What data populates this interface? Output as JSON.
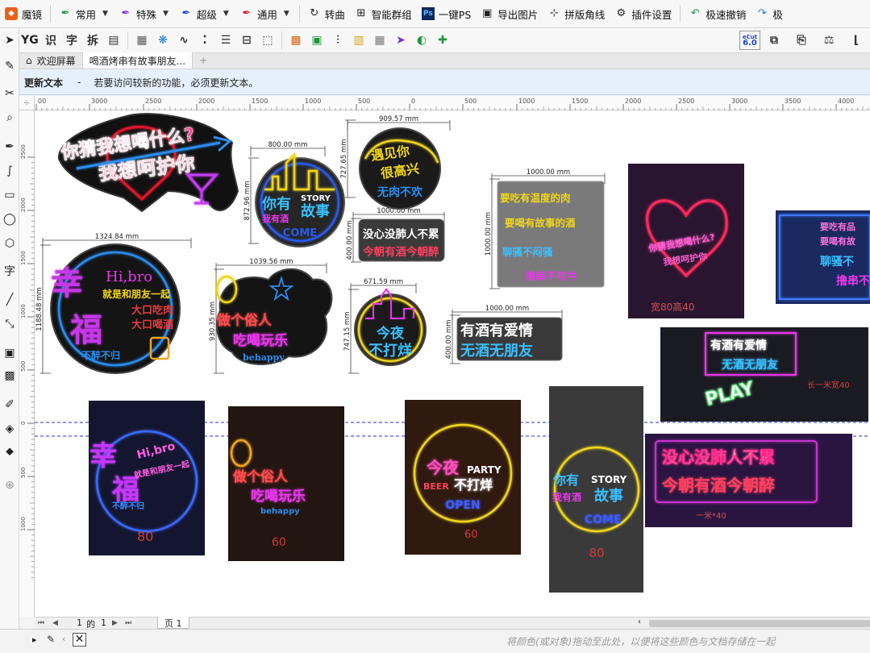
{
  "toolbar": {
    "app_title": "魔镜",
    "items": [
      {
        "label": "常用",
        "icon": "pen-icon",
        "dropdown": true
      },
      {
        "label": "特殊",
        "icon": "pen-icon",
        "dropdown": true
      },
      {
        "label": "超级",
        "icon": "pen-icon",
        "dropdown": true
      },
      {
        "label": "通用",
        "icon": "pen-icon",
        "dropdown": true
      },
      {
        "label": "转曲",
        "icon": "rotate-icon",
        "dropdown": false
      },
      {
        "label": "智能群组",
        "icon": "group-icon",
        "dropdown": false
      },
      {
        "label": "一键PS",
        "icon": "ps-icon",
        "dropdown": false
      },
      {
        "label": "导出图片",
        "icon": "image-icon",
        "dropdown": false
      },
      {
        "label": "拼版角线",
        "icon": "crop-mark-icon",
        "dropdown": false
      },
      {
        "label": "插件设置",
        "icon": "gear-icon",
        "dropdown": false
      },
      {
        "label": "极速撤销",
        "icon": "undo-icon",
        "dropdown": false
      },
      {
        "label": "极",
        "icon": "redo-icon",
        "dropdown": false
      }
    ],
    "row2_text": [
      "识",
      "字",
      "拆"
    ],
    "cut_version": "6.0",
    "cut_label": "eCut"
  },
  "tabs": [
    {
      "label": "欢迎屏幕",
      "icon": "home-icon"
    },
    {
      "label": "喝酒烤串有故事朋友..."
    }
  ],
  "notice": {
    "title": "更新文本",
    "dash": "-",
    "message": "若要访问较新的功能，必须更新文本。"
  },
  "ruler": {
    "h_ticks": [
      "00",
      "3000",
      "2500",
      "2000",
      "1500",
      "1000",
      "500",
      "0",
      "500",
      "1000",
      "1500",
      "2000",
      "2500",
      "3000",
      "3500",
      "4000"
    ],
    "v_ticks": [
      "2500",
      "2000",
      "1500",
      "1000",
      "500",
      "0",
      "500",
      "1000"
    ]
  },
  "canvas": {
    "dimensions": [
      "800.00 mm",
      "872.96 mm",
      "909.57 mm",
      "727.65 mm",
      "1000.00 mm",
      "400.00 mm",
      "1000.00 mm",
      "1000.00 mm",
      "1324.84 mm",
      "1188.48 mm",
      "1039.56 mm",
      "930.35 mm",
      "671.59 mm",
      "747.15 mm",
      "1000.00 mm",
      "400.00 mm"
    ],
    "designs": {
      "d1": [
        "你猜我想喝什么?",
        "我想呵护你"
      ],
      "d2": [
        "你有",
        "STORY",
        "我有酒",
        "故事",
        "COME"
      ],
      "d3": [
        "遇见你",
        "很高兴",
        "无肉不欢"
      ],
      "d4": [
        "没心没肺人不累",
        "今朝有酒今朝醉"
      ],
      "d5": [
        "要吃有温度的肉",
        "要喝有故事的酒",
        "聊骚不闷骚",
        "撸串不吹牛"
      ],
      "d6": [
        "幸",
        "福",
        "Hi,bro",
        "就是和朋友一起",
        "大口吃肉",
        "大口喝酒",
        "不醉不归"
      ],
      "d7": [
        "做个俗人",
        "吃喝玩乐",
        "behappy"
      ],
      "d8": [
        "今夜",
        "不打烊"
      ],
      "d9": [
        "有酒有爱情",
        "无酒无朋友"
      ]
    },
    "photos": {
      "p1": [
        "你猜我想喝什么?",
        "我想呵护你",
        "宽80高40"
      ],
      "p2": [
        "要吃有品",
        "要喝有故",
        "聊骚不",
        "撸串不"
      ],
      "p3": [
        "有酒有爱情",
        "无酒无朋友",
        "PLAY",
        "长一米宽40"
      ],
      "p4": [
        "幸",
        "福",
        "Hi,bro",
        "就是和朋友一起",
        "不醉不归",
        "80"
      ],
      "p5": [
        "做个俗人",
        "吃喝玩乐",
        "behappy",
        "60"
      ],
      "p6": [
        "今夜",
        "PARTY",
        "BEER",
        "不打烊",
        "OPEN",
        "60"
      ],
      "p7": [
        "你有",
        "STORY",
        "我有酒",
        "故事",
        "COME",
        "80"
      ],
      "p8": [
        "没心没肺人不累",
        "今朝有酒今朝醉",
        "一米*40"
      ]
    }
  },
  "pager": {
    "current": "1",
    "of": "的",
    "total": "1",
    "page_label": "页 1"
  },
  "status": {
    "hint": "将颜色(或对象)拖动至此处，以便将这些颜色与文档存储在一起"
  }
}
